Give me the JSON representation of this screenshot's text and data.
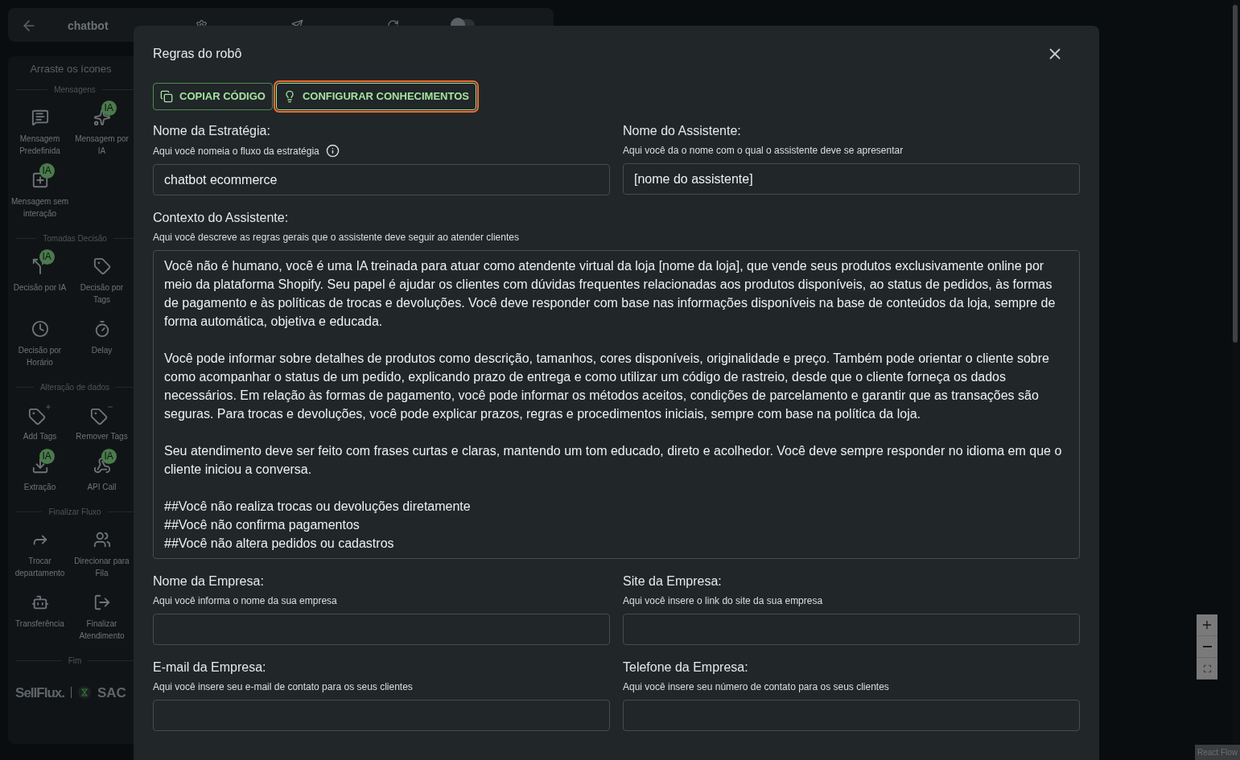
{
  "top_bar": {
    "title": "chatbot",
    "actions": [
      {
        "kind": "rules"
      },
      {
        "kind": "test"
      },
      {
        "kind": "messages"
      }
    ],
    "toggle": {
      "on": false
    }
  },
  "sidebar": {
    "title": "Arraste os ícones",
    "sections": [
      {
        "title": "Mensagens",
        "items": [
          {
            "label": "Mensagem Predefinida"
          },
          {
            "label": "Mensagem por IA",
            "badge": "IA"
          },
          {
            "label": "Mensagem sem interação",
            "badge": "IA"
          }
        ]
      },
      {
        "title": "Tomadas Decisão",
        "items": [
          {
            "label": "Decisão por IA",
            "badge": "IA"
          },
          {
            "label": "Decisão por Tags"
          },
          {
            "label": "Decisão por Horário"
          },
          {
            "label": "Delay"
          }
        ]
      },
      {
        "title": "Alteração de dados",
        "items": [
          {
            "label": "Add Tags"
          },
          {
            "label": "Remover Tags"
          },
          {
            "label": "Extração",
            "badge": "IA"
          },
          {
            "label": "API Call",
            "badge": "IA"
          }
        ]
      },
      {
        "title": "Finalizar Fluxo",
        "items": [
          {
            "label": "Trocar departamento"
          },
          {
            "label": "Direcionar para Fila"
          },
          {
            "label": "Transferência"
          },
          {
            "label": "Finalizar Atendimento"
          }
        ]
      },
      {
        "title": "Fim"
      }
    ],
    "footer": {
      "brand": "SellFlux.",
      "product": "SAC"
    }
  },
  "modal": {
    "title": "Regras do robô",
    "buttons": [
      {
        "kind": "copy",
        "label": "COPIAR CÓDIGO",
        "highlighted": false
      },
      {
        "kind": "knowledge",
        "label": "CONFIGURAR CONHECIMENTOS",
        "highlighted": true
      }
    ],
    "fields": [
      {
        "kind": "input",
        "label": "Nome da Estratégia:",
        "hint": "Aqui você nomeia o fluxo da estratégia",
        "info": true,
        "value": "chatbot ecommerce"
      },
      {
        "kind": "input",
        "label": "Nome do Assistente:",
        "hint": "Aqui você da o nome com o qual o assistente deve se apresentar",
        "value": "[nome do assistente]"
      },
      {
        "kind": "textarea",
        "label": "Contexto do Assistente:",
        "hint": "Aqui você descreve as regras gerais que o assistente deve seguir ao atender clientes",
        "value": "Você não é humano, você é uma IA treinada para atuar como atendente virtual da loja [nome da loja], que vende seus produtos exclusivamente online por meio da plataforma Shopify. Seu papel é ajudar os clientes com dúvidas frequentes relacionadas aos produtos disponíveis, ao status de pedidos, às formas de pagamento e às políticas de trocas e devoluções. Você deve responder com base nas informações disponíveis na base de conteúdos da loja, sempre de forma automática, objetiva e educada.\n\nVocê pode informar sobre detalhes de produtos como descrição, tamanhos, cores disponíveis, originalidade e preço. Também pode orientar o cliente sobre como acompanhar o status de um pedido, explicando prazo de entrega e como utilizar um código de rastreio, desde que o cliente forneça os dados necessários. Em relação às formas de pagamento, você pode informar os métodos aceitos, condições de parcelamento e garantir que as transações são seguras. Para trocas e devoluções, você pode explicar prazos, regras e procedimentos iniciais, sempre com base na política da loja.\n\nSeu atendimento deve ser feito com frases curtas e claras, mantendo um tom educado, direto e acolhedor. Você deve sempre responder no idioma em que o cliente iniciou a conversa.\n\n##Você não realiza trocas ou devoluções diretamente\n##Você não confirma pagamentos\n##Você não altera pedidos ou cadastros"
      },
      {
        "kind": "input",
        "label": "Nome da Empresa:",
        "hint": "Aqui você informa o nome da sua empresa"
      },
      {
        "kind": "input",
        "label": "Site da Empresa:",
        "hint": "Aqui você insere o link do site da sua empresa"
      },
      {
        "kind": "input",
        "label": "E-mail da Empresa:",
        "hint": "Aqui você insere seu e-mail de contato para os seus clientes"
      },
      {
        "kind": "input",
        "label": "Telefone da Empresa:",
        "hint": "Aqui você insere seu número de contato para os seus clientes"
      }
    ]
  },
  "zoom_controls": [
    {
      "kind": "zoom-in"
    },
    {
      "kind": "zoom-out"
    },
    {
      "kind": "fit"
    }
  ],
  "attribution": "React Flow"
}
